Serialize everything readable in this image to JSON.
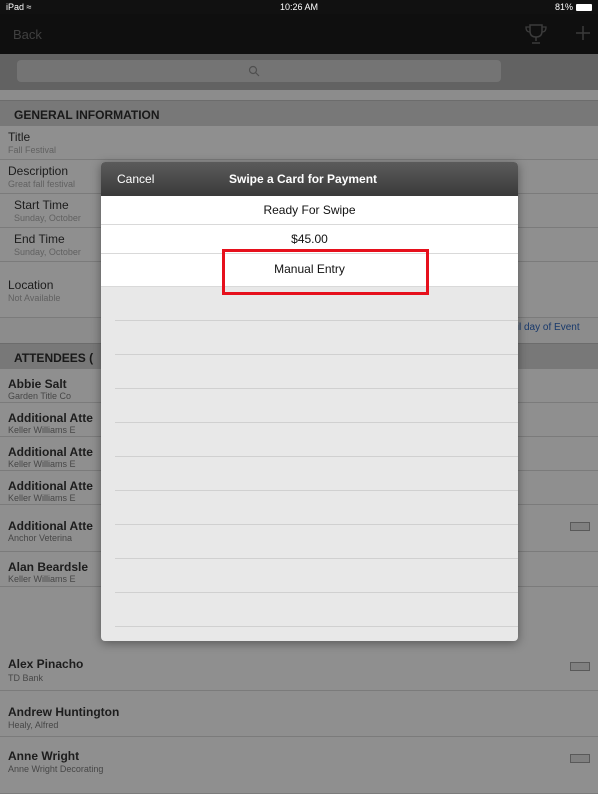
{
  "status_bar": {
    "carrier": "iPad",
    "time": "10:26 AM",
    "battery": "81%"
  },
  "navbar": {
    "back_label": "Back"
  },
  "search": {
    "placeholder": ""
  },
  "general_info": {
    "header": "GENERAL INFORMATION",
    "title_label": "Title",
    "title_value": "Fall Festival",
    "description_label": "Description",
    "description_value": "Great fall festival",
    "start_label": "Start Time",
    "start_value": "Sunday, October",
    "end_label": "End Time",
    "end_value": "Sunday, October",
    "location_label": "Location",
    "location_value": "Not Available",
    "side_note": "til day of Event"
  },
  "attendees": {
    "header": "ATTENDEES (",
    "items": [
      {
        "name": "Abbie Salt",
        "company": "Garden Title Co"
      },
      {
        "name": "Additional Atte",
        "company": "Keller Williams E"
      },
      {
        "name": "Additional Atte",
        "company": "Keller Williams E"
      },
      {
        "name": "Additional Atte",
        "company": "Keller Williams E"
      },
      {
        "name": "Additional Atte",
        "company": "Anchor Veterina"
      },
      {
        "name": "Alan Beardsle",
        "company": "Keller Williams E"
      },
      {
        "name": "Alex Pinacho",
        "company": "TD Bank"
      },
      {
        "name": "Andrew Huntington",
        "company": "Healy, Alfred"
      },
      {
        "name": "Anne Wright",
        "company": "Anne Wright Decorating"
      }
    ]
  },
  "modal": {
    "cancel_label": "Cancel",
    "title": "Swipe a Card for Payment",
    "ready_text": "Ready For Swipe",
    "amount": "$45.00",
    "manual_entry_label": "Manual Entry"
  },
  "colors": {
    "highlight": "#e6101c",
    "navbar": "#1b1b1b",
    "link": "#2a62b8"
  },
  "icons": [
    "wifi-icon",
    "battery-icon",
    "trophy-icon",
    "plus-icon",
    "search-icon",
    "business-card-icon"
  ]
}
